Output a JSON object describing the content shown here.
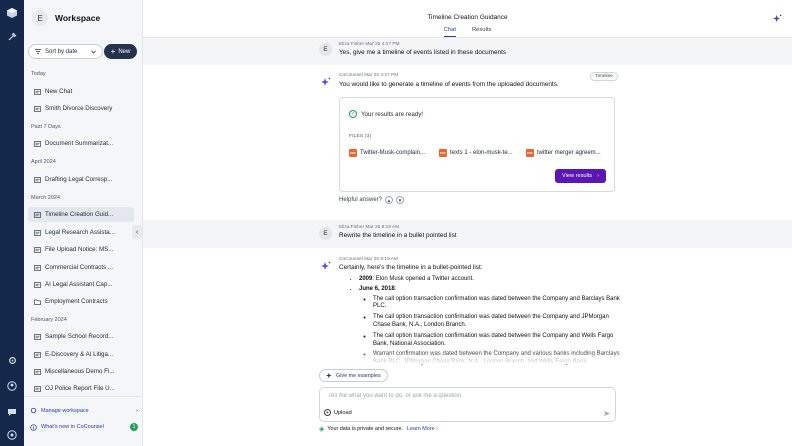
{
  "rail": {
    "icons": [
      "app-logo-icon",
      "tools-icon",
      "settings-icon",
      "profile-icon",
      "chat-icon",
      "help-icon"
    ]
  },
  "sidebar": {
    "avatar_letter": "E",
    "title": "Workspace",
    "sort_label": "Sort by date",
    "new_label": "New",
    "groups": [
      {
        "label": "Today",
        "items": [
          "New Chat",
          "Smith Divorce Discovery"
        ]
      },
      {
        "label": "Past 7 Days",
        "items": [
          "Document Summarizat..."
        ]
      },
      {
        "label": "April 2024",
        "items": [
          "Drafting Legal Corresp..."
        ]
      },
      {
        "label": "March 2024",
        "items": [
          "Timeline Creation Guid...",
          "Legal Research Assista...",
          "File Upload Notice: MS...",
          "Commercial Contracts ...",
          "AI Legal Assistant Cap...",
          "Employment Contracts"
        ]
      },
      {
        "label": "February 2024",
        "items": [
          "Sample School Record...",
          "E-Discovery & AI Litiga...",
          "Miscellaneous Demo Fi...",
          "OJ Police Report File U..."
        ]
      }
    ],
    "manage_label": "Manage workspace",
    "whats_new_label": "What's new in CoCounsel",
    "whats_new_count": "1"
  },
  "header": {
    "title": "Timeline Creation Guidance",
    "tabs": [
      "Chat",
      "Results"
    ]
  },
  "chat": {
    "msg1": {
      "avatar": "E",
      "meta": "Eliza Fisher  Mar 25 4:27 PM",
      "text": "Yes, give me a timeline of events listed in these documents"
    },
    "msg2": {
      "meta": "CoCounsel  Mar 25 4:27 PM",
      "pill": "Timeline",
      "text": "You would like to generate a timeline of events from the uploaded documents.",
      "ready": "Your results are ready!",
      "files_label": "FILES (3)",
      "files": [
        "Twitter-Musk-complain...",
        "texts 1 - elon-musk-te...",
        "twitter merger agreem..."
      ],
      "pdf_badge": "PDF",
      "view_label": "View results",
      "helpful": "Helpful answer?"
    },
    "msg3": {
      "avatar": "E",
      "meta": "Eliza Fisher  Mar 25 9:19 AM",
      "text": "Rewrite the timeline in a bullet pointed list"
    },
    "msg4": {
      "meta": "CoCounsel  Mar 25 9:19 AM",
      "text": "Certainly, here's the timeline in a bullet-pointed list:",
      "b1_date": "2009",
      "b1_text": ": Elon Musk opened a Twitter account.",
      "b2_date": "June 6, 2018",
      "b2_colon": ":",
      "sub": [
        "The call option transaction confirmation was dated between the Company and Barclays Bank PLC.",
        "The call option transaction confirmation was dated between the Company and JPMorgan Chase Bank, N.A., London Branch.",
        "The call option transaction confirmation was dated between the Company and Wells Fargo Bank, National Association.",
        "Warrant confirmation was dated between the Company and various banks including Barclays Bank PLC, JPMorgan Chase Bank, N.A., London Branch, and Wells Fargo Bank,"
      ]
    }
  },
  "composer": {
    "examples_label": "Give me examples",
    "placeholder": "Tell me what you want to do, or ask me a question",
    "upload_label": "Upload",
    "privacy": "Your data is private and secure.",
    "learn_more": "Learn More"
  },
  "colors": {
    "rail": "#14284b",
    "accent_purple": "#5b17b3",
    "link_blue": "#1e40af",
    "pdf_orange": "#f0642c"
  }
}
